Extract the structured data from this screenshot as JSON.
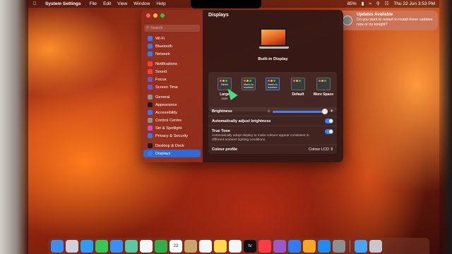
{
  "menubar": {
    "app_name": "System Settings",
    "menus": [
      "File",
      "Edit",
      "View",
      "Window",
      "Help"
    ],
    "battery": "85%",
    "clock": "Thu 22 Jun  3:53 PM"
  },
  "notification": {
    "title": "Updates Available",
    "body": "Do you want to restart to install these updates now or try tonight?"
  },
  "sidebar": {
    "search_placeholder": "Search",
    "groups": [
      {
        "items": [
          {
            "label": "Wi-Fi",
            "color": "#2f7cf6"
          },
          {
            "label": "Bluetooth",
            "color": "#2f7cf6"
          },
          {
            "label": "Network",
            "color": "#2f7cf6"
          }
        ]
      },
      {
        "items": [
          {
            "label": "Notifications",
            "color": "#f04438"
          },
          {
            "label": "Sound",
            "color": "#f04438"
          },
          {
            "label": "Focus",
            "color": "#6e56cf"
          },
          {
            "label": "Screen Time",
            "color": "#6e56cf"
          }
        ]
      },
      {
        "items": [
          {
            "label": "General",
            "color": "#8e8e93"
          },
          {
            "label": "Appearance",
            "color": "#1c1c1e"
          },
          {
            "label": "Accessibility",
            "color": "#2f7cf6"
          },
          {
            "label": "Control Centre",
            "color": "#8e8e93"
          },
          {
            "label": "Siri & Spotlight",
            "color": "#c84dd4"
          },
          {
            "label": "Privacy & Security",
            "color": "#2f7cf6"
          }
        ]
      },
      {
        "items": [
          {
            "label": "Desktop & Dock",
            "color": "#1c1c1e"
          },
          {
            "label": "Displays",
            "color": "#2f7cf6",
            "active": true
          }
        ]
      }
    ]
  },
  "main": {
    "title": "Displays",
    "display_name": "Built-in Display",
    "resolutions": [
      {
        "label": "Large",
        "sub": "1024",
        "thumb_text": "Here's",
        "selected": false
      },
      {
        "label": "",
        "thumb_text": "Here's to troublem",
        "selected": false
      },
      {
        "label": "",
        "thumb_text": "Here's to troublem",
        "selected": true
      },
      {
        "label": "Default",
        "thumb_text": "",
        "selected": false
      },
      {
        "label": "More Space",
        "thumb_text": "",
        "selected": false
      }
    ],
    "brightness_label": "Brightness",
    "brightness_value": 0.95,
    "auto_brightness_label": "Automatically adjust brightness",
    "auto_brightness_on": true,
    "true_tone_label": "True Tone",
    "true_tone_desc": "Automatically adapt display to make colours appear consistent in different ambient lighting conditions.",
    "true_tone_on": true,
    "colour_profile_label": "Colour profile",
    "colour_profile_value": "Colour LCD"
  },
  "dock": {
    "icons": [
      {
        "name": "finder",
        "color": "#3b8df0"
      },
      {
        "name": "launchpad",
        "color": "#d0d0d8"
      },
      {
        "name": "safari",
        "color": "#2a9df4"
      },
      {
        "name": "messages",
        "color": "#34c759"
      },
      {
        "name": "mail",
        "color": "#3a8ff7"
      },
      {
        "name": "maps",
        "color": "#5ac8a0"
      },
      {
        "name": "photos",
        "color": "#f6f6f6"
      },
      {
        "name": "facetime",
        "color": "#2bb24c"
      },
      {
        "name": "calendar",
        "color": "#ffffff",
        "text": "22"
      },
      {
        "name": "contacts",
        "color": "#c9a56a"
      },
      {
        "name": "reminders",
        "color": "#f5f5f5"
      },
      {
        "name": "notes",
        "color": "#ffd84d"
      },
      {
        "name": "freeform",
        "color": "#f5f5f5"
      },
      {
        "name": "tv",
        "color": "#111111",
        "text": "tv"
      },
      {
        "name": "music",
        "color": "#fc3c44"
      },
      {
        "name": "podcasts",
        "color": "#9b59d0"
      },
      {
        "name": "keynote",
        "color": "#2f7cf6"
      },
      {
        "name": "pages",
        "color": "#f5a623"
      },
      {
        "name": "app-store",
        "color": "#1f8cf5"
      },
      {
        "name": "system-settings",
        "color": "#8e8e93"
      },
      {
        "name": "downloads",
        "color": "#4ba3f5"
      },
      {
        "name": "trash",
        "color": "#c8c8cc"
      }
    ]
  }
}
